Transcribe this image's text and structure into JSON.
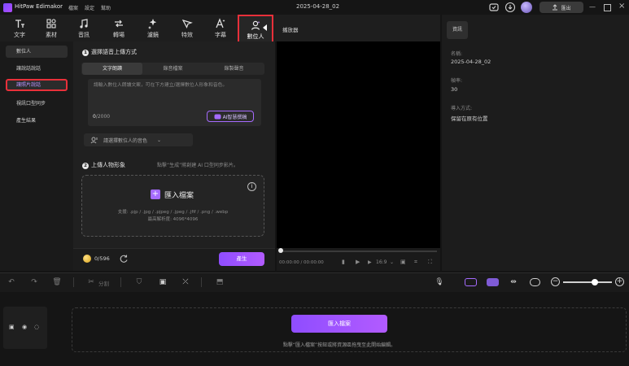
{
  "app": {
    "name": "HitPaw Edimakor",
    "menus": [
      "檔案",
      "設定",
      "幫助"
    ],
    "project_name": "2025-04-28_02",
    "export_label": "匯出"
  },
  "toolbar": {
    "tools": [
      {
        "label": "文字",
        "icon": "text-icon"
      },
      {
        "label": "素材",
        "icon": "assets-icon"
      },
      {
        "label": "音訊",
        "icon": "music-icon"
      },
      {
        "label": "轉場",
        "icon": "transition-icon"
      },
      {
        "label": "濾鏡",
        "icon": "filter-icon"
      },
      {
        "label": "特效",
        "icon": "effects-icon"
      },
      {
        "label": "字幕",
        "icon": "subtitle-icon"
      },
      {
        "label": "數位人",
        "icon": "avatar-icon"
      }
    ]
  },
  "sidebar": {
    "items": [
      {
        "label": "數位人"
      },
      {
        "label": "讓說話說話"
      },
      {
        "label": "讓照片說話"
      },
      {
        "label": "視訊口型同步"
      },
      {
        "label": "產生結果"
      }
    ]
  },
  "section1": {
    "number": "1",
    "title": "選擇語音上傳方式",
    "tabs": [
      "文字朗讀",
      "錄音檔案",
      "錄製聲音"
    ],
    "placeholder": "請輸入數位人朗讀文案，可在下方建立/選擇數位人形象和音色。",
    "count": "0",
    "max": "/2000",
    "ai_button": "AI智慧撰稿",
    "voice_select": "請選擇數位人的音色"
  },
  "section2": {
    "number": "2",
    "title": "上傳人物形象",
    "hint": "點擊“生成”將創建 AI 口型同步影片。",
    "import_label": "匯入檔案",
    "supported": "支援: .pjp / .jpg / .pjpeg / .jpeg / .jfif / .png / .webp",
    "max_resolution": "最高解析度: 4096*4096"
  },
  "footer": {
    "credits": "0/596",
    "generate_label": "產生"
  },
  "player": {
    "title": "播放器",
    "timecode": "00:00:00 / 00:00:00",
    "ratio": "16:9"
  },
  "properties": {
    "tab": "資訊",
    "name_label": "名稱:",
    "name_value": "2025-04-28_02",
    "fps_label": "幀率:",
    "fps_value": "30",
    "import_mode_label": "導入方式:",
    "import_mode_value": "保留在原有位置"
  },
  "timeline": {
    "split_label": "分割",
    "import_label": "匯入檔案",
    "hint": "點擊“匯入檔案”按鈕或將資源區拖曳至此開始編輯。",
    "zoom_level": 0.65
  },
  "colors": {
    "accent": "#a56bff",
    "highlight": "#e8303a",
    "background": "#141414"
  }
}
